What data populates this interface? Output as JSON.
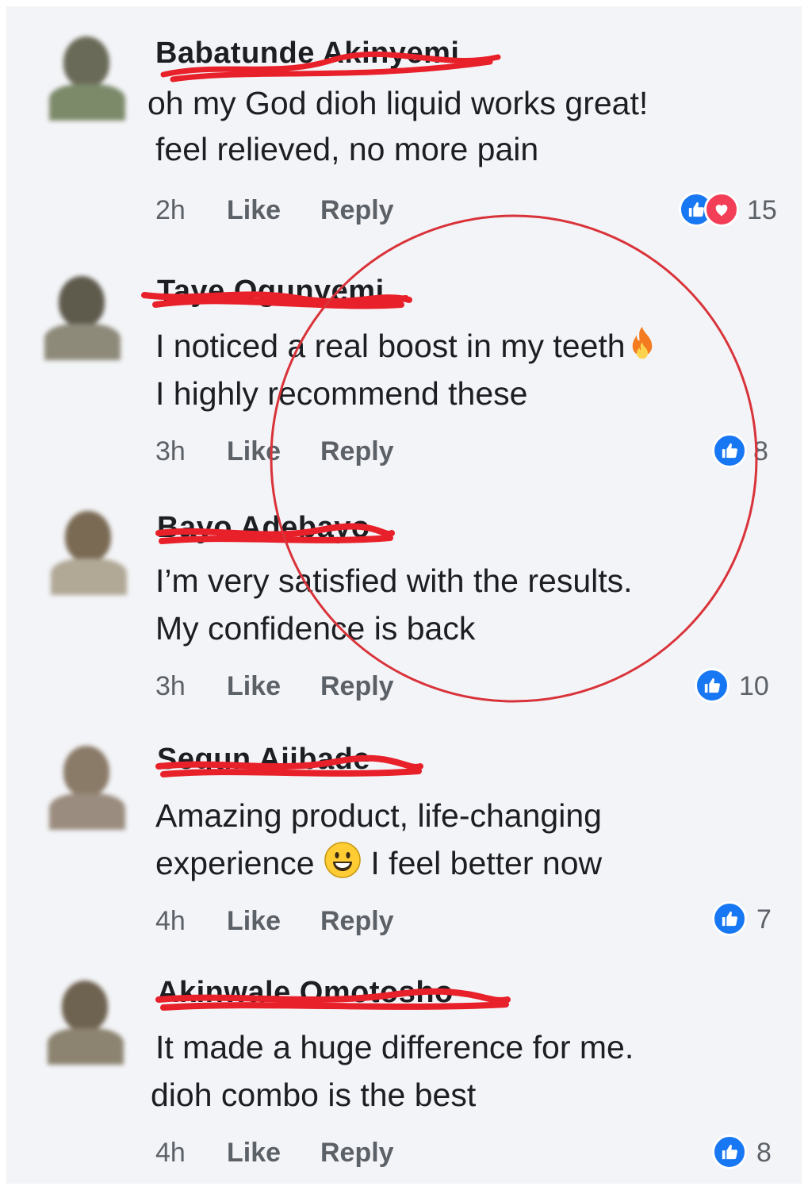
{
  "comments": [
    {
      "name": "Babatunde Akinyemi",
      "line1": "oh my God  dioh liquid  works great!",
      "line2": "feel  relieved,  no more pain",
      "time": "2h",
      "like_label": "Like",
      "reply_label": "Reply",
      "reaction_count": "15",
      "reactions": [
        "like",
        "love"
      ]
    },
    {
      "name": "Taye Ogunyemi",
      "line1": "I noticed a real boost in my teeth",
      "line1_emoji": "fire",
      "line2": "I highly recommend these",
      "time": "3h",
      "like_label": "Like",
      "reply_label": "Reply",
      "reaction_count": "8",
      "reactions": [
        "like"
      ]
    },
    {
      "name": "Bayo Adebayo",
      "line1": "I’m very satisfied with the results.",
      "line2": "My confidence is back",
      "time": "3h",
      "like_label": "Like",
      "reply_label": "Reply",
      "reaction_count": "10",
      "reactions": [
        "like"
      ]
    },
    {
      "name": "Segun Ajibade",
      "line1": "Amazing product, life-changing",
      "line2a": "experience",
      "line2_emoji": "smiley",
      "line2b": "I feel  better now",
      "time": "4h",
      "like_label": "Like",
      "reply_label": "Reply",
      "reaction_count": "7",
      "reactions": [
        "like"
      ]
    },
    {
      "name": "Akinwale Omotosho",
      "line1": "It made a huge difference for me.",
      "line2": "dioh combo is the best",
      "time": "4h",
      "like_label": "Like",
      "reply_label": "Reply",
      "reaction_count": "8",
      "reactions": [
        "like"
      ]
    }
  ],
  "colors": {
    "background": "#f3f4f7",
    "redaction": "#e8202a",
    "annotation_circle": "#d9333a",
    "like_blue": "#1877f2",
    "love_red": "#f33e58",
    "meta_gray": "#5c6168"
  }
}
